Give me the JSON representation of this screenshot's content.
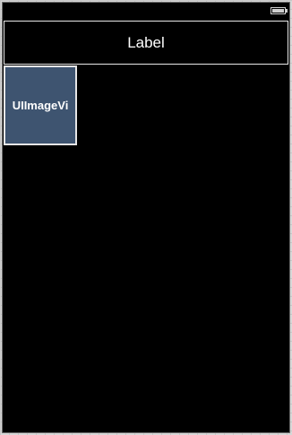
{
  "status_bar": {
    "battery_icon": "battery-icon"
  },
  "label": {
    "text": "Label"
  },
  "image_view": {
    "text": "UIImageVi",
    "background_color": "#3e5470"
  }
}
